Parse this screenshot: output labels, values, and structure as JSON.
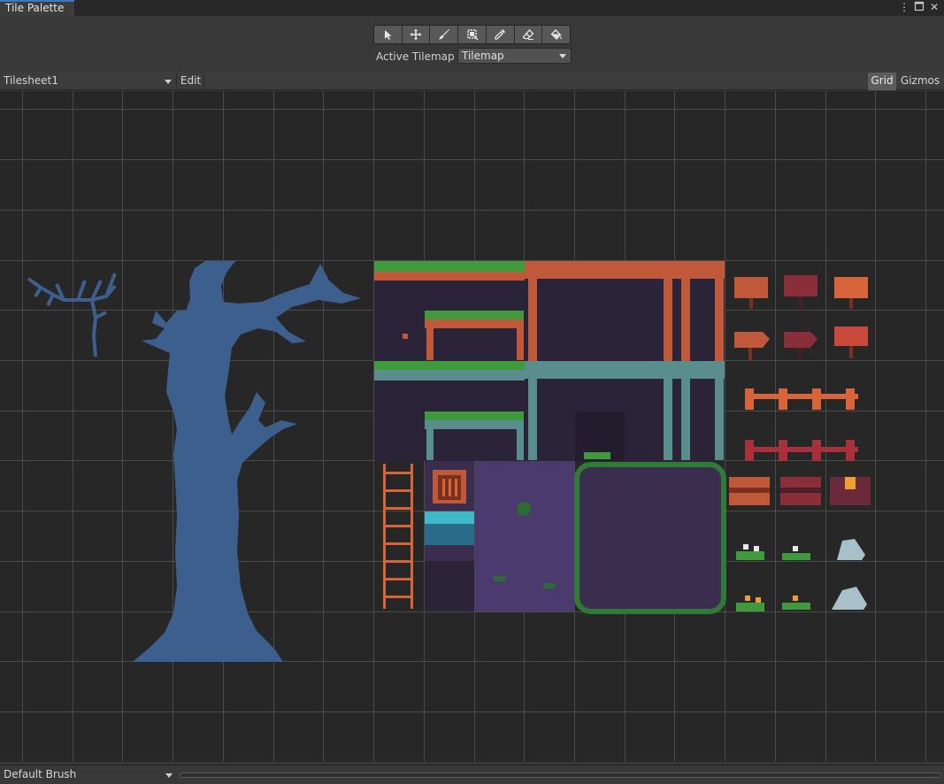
{
  "window": {
    "tab_title": "Tile Palette"
  },
  "toolbar": {
    "tools": [
      {
        "name": "select-icon"
      },
      {
        "name": "move-icon"
      },
      {
        "name": "paintbrush-icon"
      },
      {
        "name": "box-fill-icon"
      },
      {
        "name": "picker-icon"
      },
      {
        "name": "eraser-icon"
      },
      {
        "name": "fill-bucket-icon"
      }
    ],
    "active_tilemap_label": "Active Tilemap",
    "active_tilemap_value": "Tilemap"
  },
  "palette_bar": {
    "palette_value": "Tilesheet1",
    "edit_label": "Edit",
    "grid_label": "Grid",
    "gizmos_label": "Gizmos"
  },
  "bottom_bar": {
    "brush_value": "Default Brush"
  },
  "colors": {
    "accent": "#3a79bb",
    "tree": "#3d5f8e",
    "brick": "#c0583a",
    "moss": "#3f9a3c",
    "stone": "#5a8e8c",
    "purple_bg": "#2b2438",
    "purple_mid": "#4a3a6e"
  }
}
